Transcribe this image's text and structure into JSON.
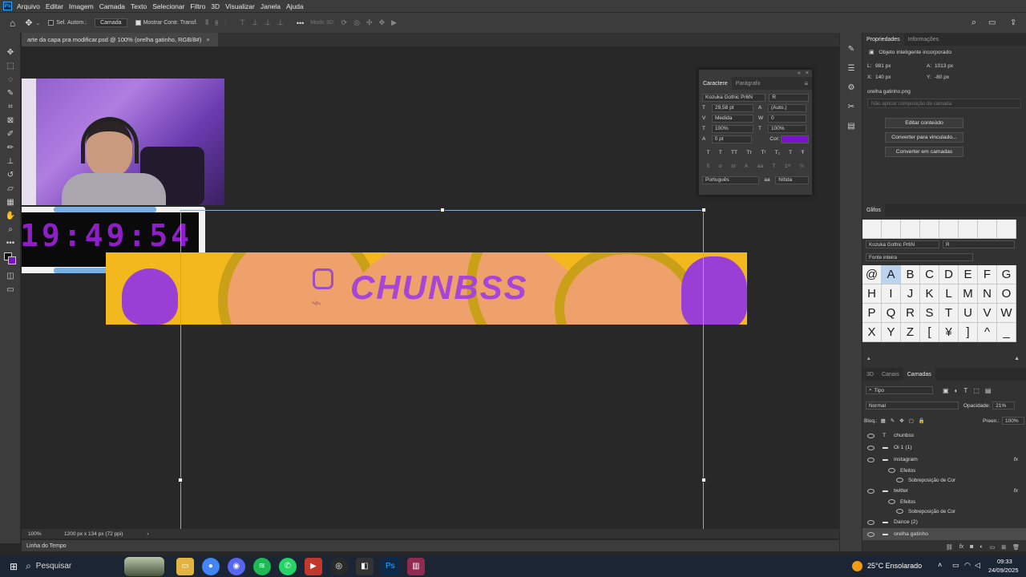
{
  "app": {
    "logo": "Ps"
  },
  "menu": [
    "Arquivo",
    "Editar",
    "Imagem",
    "Camada",
    "Texto",
    "Selecionar",
    "Filtro",
    "3D",
    "Visualizar",
    "Janela",
    "Ajuda"
  ],
  "options": {
    "auto_select_label": "Sel. Autom.:",
    "layer_select": "Camada",
    "show_transform_label": "Mostrar Contr. Transf.",
    "mode3d": "Modo 3D:"
  },
  "document": {
    "tab_title": "arte da capa pra modificar.psd @ 100% (orelha gatinho, RGB/8#)",
    "close": "×",
    "zoom": "100%",
    "size_info": "1200 px x 134 px (72 ppi)"
  },
  "canvas": {
    "clock": "19:49:54",
    "banner_title": "CHUNBSS",
    "banner_bg": "#f4b81f"
  },
  "timeline": {
    "label": "Linha do Tempo"
  },
  "character": {
    "tabs": [
      "Caractere",
      "Parágrafo"
    ],
    "font": "Kozuka Gothic Pr6N",
    "style": "R",
    "size": "29,58 pt",
    "leading": "(Auto.)",
    "kerning": "Medida",
    "tracking": "0",
    "vscale": "100%",
    "hscale": "100%",
    "baseline": "0 pt",
    "color_label": "Cor:",
    "color": "#7a12c8",
    "language": "Português",
    "aa_mode": "Nítida"
  },
  "properties": {
    "tabs": [
      "Propriedades",
      "Informações"
    ],
    "object_type": "Objeto inteligente incorporado",
    "w_label": "L:",
    "w": "981 px",
    "h_label": "A:",
    "h": "1013 px",
    "x_label": "X:",
    "x": "140 px",
    "y_label": "Y:",
    "y": "-80 px",
    "filename": "orelha gatinho.png",
    "comp_placeholder": "Não aplicar composição de camada",
    "buttons": [
      "Editar conteúdo",
      "Converter para vinculado...",
      "Converter em camadas"
    ]
  },
  "glyphs": {
    "title": "Glifos",
    "font": "Kozuka Gothic Pr6N",
    "style": "R",
    "subset": "Fonte inteira",
    "cells": [
      "@",
      "A",
      "B",
      "C",
      "D",
      "E",
      "F",
      "G",
      "H",
      "I",
      "J",
      "K",
      "L",
      "M",
      "N",
      "O",
      "P",
      "Q",
      "R",
      "S",
      "T",
      "U",
      "V",
      "W",
      "X",
      "Y",
      "Z",
      "[",
      "¥",
      "]",
      "^",
      "_"
    ]
  },
  "layers": {
    "tabs": [
      "3D",
      "Canais",
      "Camadas"
    ],
    "filter": "Tipo",
    "blend": "Normal",
    "opacity_label": "Opacidade:",
    "opacity": "21%",
    "lock_label": "Bloq.:",
    "fill_label": "Preen.:",
    "fill": "100%",
    "items": [
      {
        "name": "chunbss",
        "type": "T",
        "indent": 0
      },
      {
        "name": "Oi 1 (1)",
        "type": "img",
        "indent": 0
      },
      {
        "name": "instagram",
        "type": "img",
        "indent": 0,
        "fx": "fx"
      },
      {
        "name": "Efeitos",
        "type": "fx",
        "indent": 1
      },
      {
        "name": "Sobreposição de Cor",
        "type": "fx",
        "indent": 2
      },
      {
        "name": "twitter",
        "type": "img",
        "indent": 0,
        "fx": "fx"
      },
      {
        "name": "Efeitos",
        "type": "fx",
        "indent": 1
      },
      {
        "name": "Sobreposição de Cor",
        "type": "fx",
        "indent": 2
      },
      {
        "name": "Dance (2)",
        "type": "img",
        "indent": 0
      },
      {
        "name": "orelha gatinho",
        "type": "img",
        "indent": 0,
        "selected": true
      }
    ]
  },
  "taskbar": {
    "search": "Pesquisar",
    "weather": "25°C  Ensolarado",
    "time": "09:33",
    "date": "24/09/2025"
  }
}
